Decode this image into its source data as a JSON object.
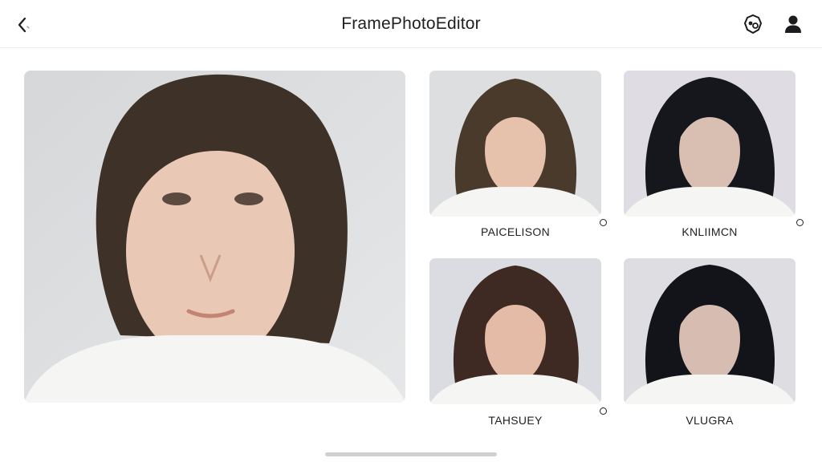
{
  "header": {
    "title": "FramePhotoEditor",
    "back_icon": "chevron-left-icon",
    "badge_icon": "badge-settings-icon",
    "user_icon": "user-icon"
  },
  "main_photo": {
    "description_icon": "portrait-photo"
  },
  "styles": [
    {
      "label": "PAICELISON",
      "hair": "#4a3a2c",
      "skin": "#e6c2ad"
    },
    {
      "label": "KNLIIMCN",
      "hair": "#15171c",
      "skin": "#d9bfb2"
    },
    {
      "label": "TAHSUEY",
      "hair": "#3e2a22",
      "skin": "#e3bba6"
    },
    {
      "label": "VLUGRA",
      "hair": "#121419",
      "skin": "#d6bcb1"
    }
  ],
  "colors": {
    "background": "#ffffff",
    "text": "#1c1c1e",
    "divider": "#ececec"
  }
}
